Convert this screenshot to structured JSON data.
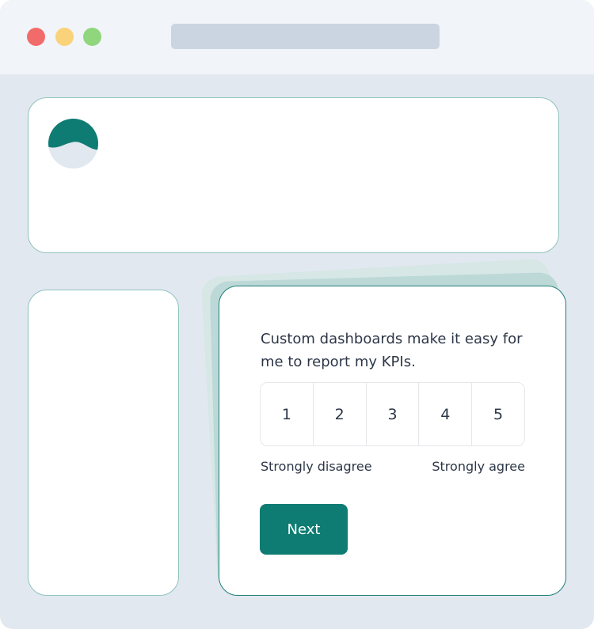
{
  "browser": {
    "controls": [
      "close",
      "minimize",
      "maximize"
    ],
    "control_colors": {
      "close": "#f26b6b",
      "minimize": "#fad27a",
      "maximize": "#8fd67c"
    }
  },
  "header_card": {
    "logo": "wave-logo-icon"
  },
  "survey": {
    "question": "Custom dashboards make it easy for me to report my KPIs.",
    "scale": [
      "1",
      "2",
      "3",
      "4",
      "5"
    ],
    "min_label": "Strongly disagree",
    "max_label": "Strongly agree",
    "next_label": "Next"
  },
  "colors": {
    "accent": "#0e7c72",
    "card_border": "#8fc3bd",
    "background": "#e2e8f0",
    "text": "#2d3748"
  }
}
